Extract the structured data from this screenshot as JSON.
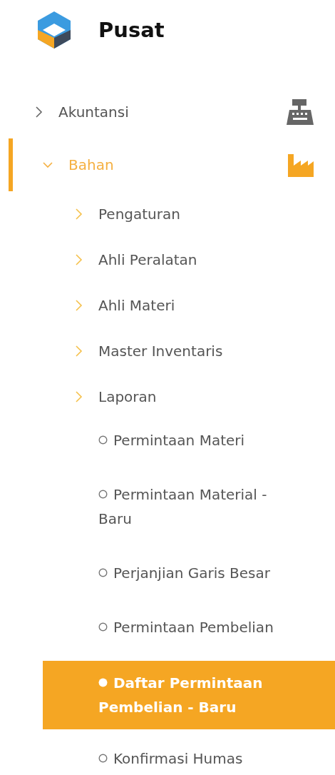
{
  "brand": {
    "title": "Pusat"
  },
  "menu": [
    {
      "label": "Akuntansi",
      "expanded": false,
      "selected": false
    },
    {
      "label": "Bahan",
      "expanded": true,
      "selected": true,
      "children": [
        {
          "label": "Pengaturan"
        },
        {
          "label": "Ahli Peralatan"
        },
        {
          "label": "Ahli Materi"
        },
        {
          "label": "Master Inventaris"
        },
        {
          "label": "Laporan",
          "children": [
            {
              "label": "Permintaan Materi",
              "selected": false
            },
            {
              "label": "Permintaan Material - Baru",
              "selected": false
            },
            {
              "label": "Perjanjian Garis Besar",
              "selected": false
            },
            {
              "label": "Permintaan Pembelian",
              "selected": false
            },
            {
              "label": "Daftar Permintaan Pembelian - Baru",
              "selected": true
            },
            {
              "label": "Konfirmasi Humas",
              "selected": false
            }
          ]
        }
      ]
    }
  ]
}
